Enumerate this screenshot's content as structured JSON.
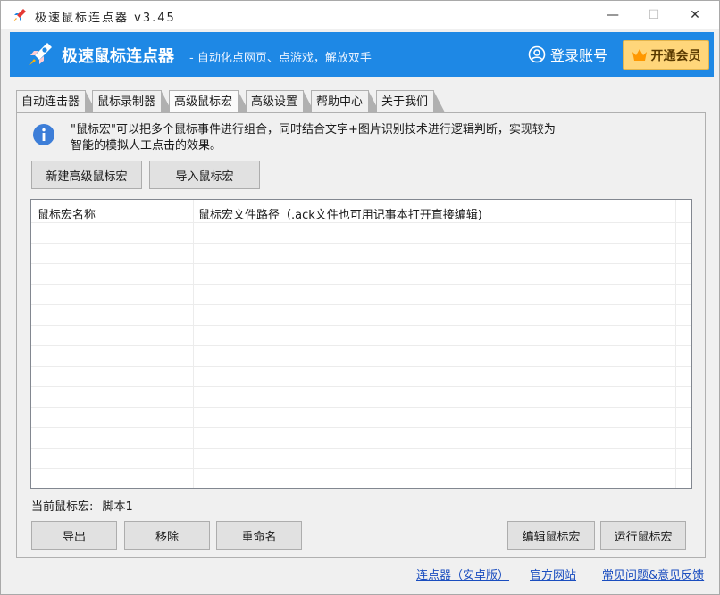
{
  "window": {
    "title": "极速鼠标连点器 v3.45",
    "controls": {
      "minimize": "—",
      "maximize": "☐",
      "close": "✕"
    }
  },
  "banner": {
    "title": "极速鼠标连点器",
    "slogan": "- 自动化点网页、点游戏，解放双手",
    "login_label": "登录账号",
    "vip_label": "开通会员",
    "background_color": "#1e88e5"
  },
  "tabs": [
    {
      "label": "自动连击器",
      "active": false
    },
    {
      "label": "鼠标录制器",
      "active": false
    },
    {
      "label": "高级鼠标宏",
      "active": true
    },
    {
      "label": "高级设置",
      "active": false
    },
    {
      "label": "帮助中心",
      "active": false
    },
    {
      "label": "关于我们",
      "active": false
    }
  ],
  "info": {
    "line1": "\"鼠标宏\"可以把多个鼠标事件进行组合，同时结合文字+图片识别技术进行逻辑判断，实现较为",
    "line2": "智能的模拟人工点击的效果。"
  },
  "actions": {
    "new_macro": "新建高级鼠标宏",
    "import_macro": "导入鼠标宏"
  },
  "table": {
    "columns": [
      "鼠标宏名称",
      "鼠标宏文件路径（.ack文件也可用记事本打开直接编辑)"
    ],
    "rows": []
  },
  "current": {
    "label": "当前鼠标宏:",
    "value": "脚本1"
  },
  "bottom_buttons": {
    "export": "导出",
    "remove": "移除",
    "rename": "重命名",
    "edit": "编辑鼠标宏",
    "run": "运行鼠标宏"
  },
  "footer_links": {
    "android": "连点器（安卓版）",
    "website": "官方网站",
    "faq": "常见问题&意见反馈"
  }
}
